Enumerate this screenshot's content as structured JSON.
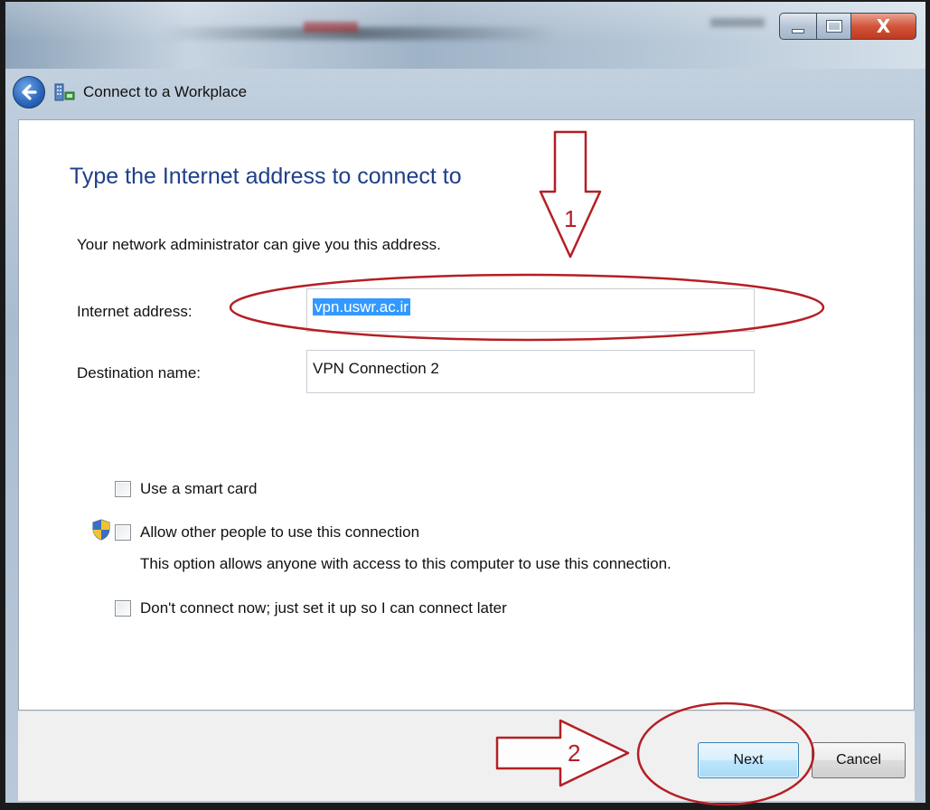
{
  "window": {
    "title": "Connect to a Workplace",
    "controls": {
      "minimize_icon": "minimize-icon",
      "maximize_icon": "maximize-icon",
      "close_glyph": "X"
    }
  },
  "page": {
    "heading": "Type the Internet address to connect to",
    "subtext": "Your network administrator can give you this address."
  },
  "form": {
    "internet_address": {
      "label": "Internet address:",
      "value": "vpn.uswr.ac.ir",
      "selected": true
    },
    "destination_name": {
      "label": "Destination name:",
      "value": "VPN Connection 2"
    }
  },
  "options": [
    {
      "label": "Use a smart card",
      "checked": false
    },
    {
      "label": "Allow other people to use this connection",
      "checked": false,
      "shield_icon": "uac-shield-icon",
      "description": "This option allows anyone with access to this computer to use this connection."
    },
    {
      "label": "Don't connect now; just set it up so I can connect later",
      "checked": false
    }
  ],
  "footer": {
    "next_label": "Next",
    "cancel_label": "Cancel"
  },
  "annotations": {
    "step1": "1",
    "step2": "2",
    "color": "#b41f24"
  },
  "colors": {
    "heading": "#1e3f8a",
    "selection": "#3399ff"
  }
}
